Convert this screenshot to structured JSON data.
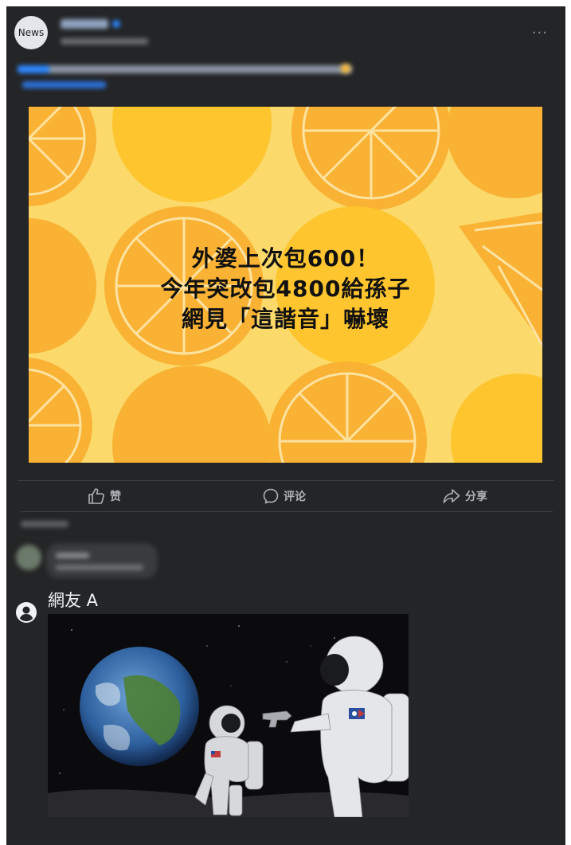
{
  "post": {
    "page_avatar_text": "News",
    "hero_headline": [
      "外婆上次包600！",
      "今年突改包4800給孫子",
      "網見「這諧音」嚇壞"
    ]
  },
  "actions": {
    "like_label": "赞",
    "comment_label": "评论",
    "share_label": "分享"
  },
  "reply": {
    "author": "網友 A"
  },
  "colors": {
    "background": "#242526",
    "hero_yellow": "#fbd96a",
    "orange": "#f9b233",
    "action_text": "#b0b3b8"
  }
}
